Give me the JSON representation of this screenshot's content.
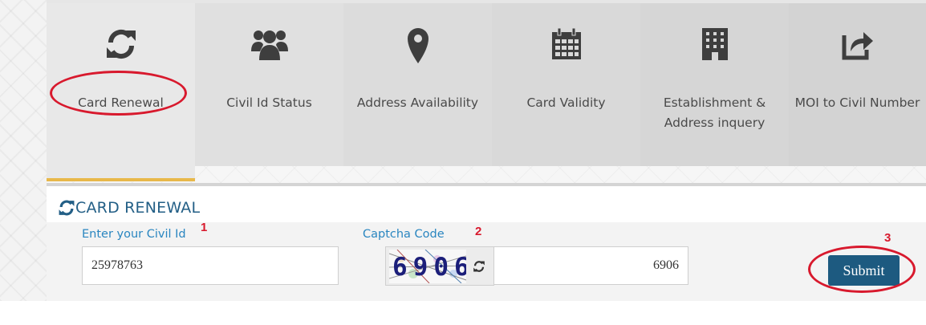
{
  "tabs": [
    {
      "label": "Card Renewal",
      "icon": "refresh-icon"
    },
    {
      "label": "Civil Id Status",
      "icon": "users-icon"
    },
    {
      "label": "Address Availability",
      "icon": "map-marker-icon"
    },
    {
      "label": "Card Validity",
      "icon": "calendar-icon"
    },
    {
      "label": "Establishment & Address inquery",
      "icon": "building-icon"
    },
    {
      "label": "MOI to Civil Number",
      "icon": "share-icon"
    }
  ],
  "section": {
    "title": "CARD RENEWAL",
    "icon": "refresh-icon"
  },
  "form": {
    "civil_id_label": "Enter your Civil Id",
    "civil_id_value": "25978763",
    "captcha_label": "Captcha Code",
    "captcha_image_text": "6906",
    "captcha_value": "6906",
    "submit_label": "Submit"
  },
  "annotations": [
    "1",
    "2",
    "3"
  ],
  "colors": {
    "accent": "#235f86",
    "active_tab_border": "#e8b84a",
    "annotation": "#d8192d",
    "submit": "#1d5a80",
    "label": "#2a86c0"
  }
}
